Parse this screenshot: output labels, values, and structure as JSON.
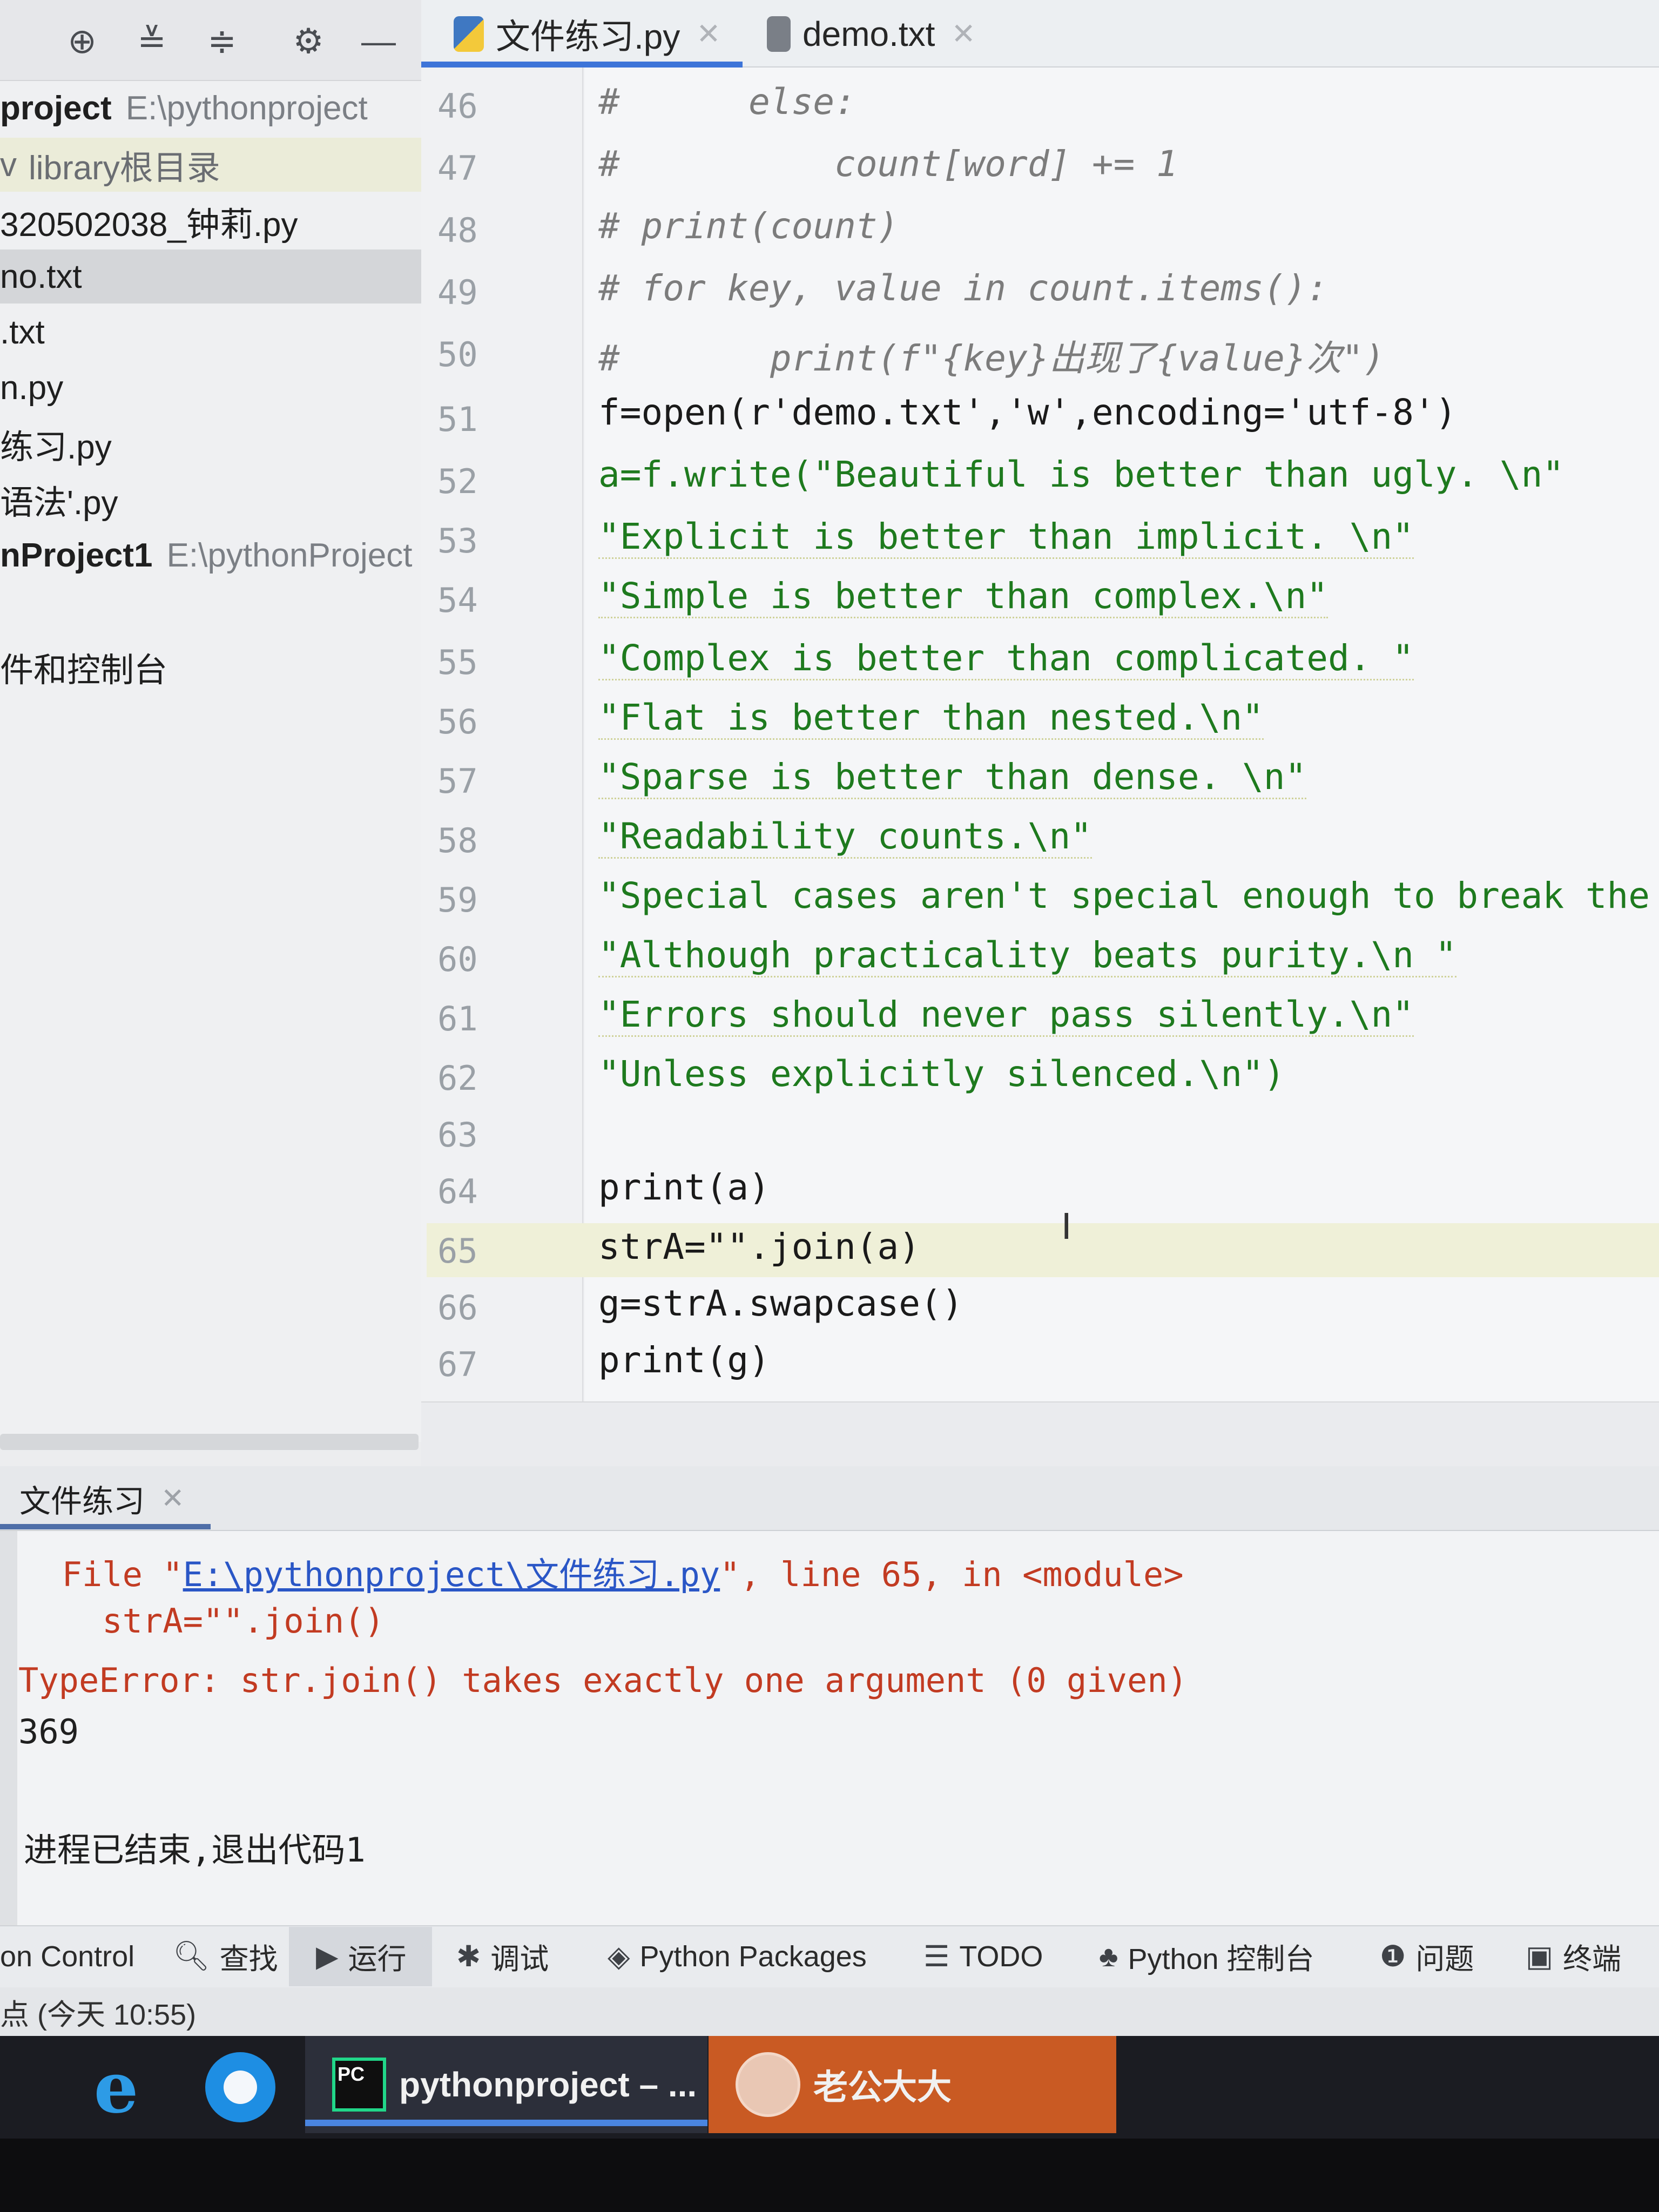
{
  "toolbar": {
    "icons": [
      "crosshair-icon",
      "expand-all-icon",
      "collapse-all-icon",
      "gear-icon",
      "minimize-icon"
    ]
  },
  "tabs": [
    {
      "label": "文件练习.py",
      "icon": "python-file-icon",
      "active": true
    },
    {
      "label": "demo.txt",
      "icon": "text-file-icon",
      "active": false
    }
  ],
  "project_tree": {
    "items": [
      {
        "label": "project",
        "detail": "E:\\pythonproject",
        "bold": true
      },
      {
        "label": "library根目录",
        "prefix": "v"
      },
      {
        "label": "320502038_钟莉.py"
      },
      {
        "label": "no.txt",
        "selected": true
      },
      {
        "label": ".txt"
      },
      {
        "label": "n.py"
      },
      {
        "label": "练习.py"
      },
      {
        "label": "语法'.py"
      },
      {
        "label": "nProject1",
        "detail": "E:\\pythonProject",
        "bold": true
      },
      {
        "label": "件和控制台"
      }
    ]
  },
  "editor": {
    "lines": [
      {
        "n": "46",
        "text": "#      else:"
      },
      {
        "n": "47",
        "text": "#          count[word] += 1"
      },
      {
        "n": "48",
        "text": "# print(count)"
      },
      {
        "n": "49",
        "text": "# for key, value in count.items():"
      },
      {
        "n": "50",
        "text": "#       print(f\"{key}出现了{value}次\")"
      },
      {
        "n": "51",
        "text": "f=open(r'demo.txt','w',encoding='utf-8')"
      },
      {
        "n": "52",
        "text": "a=f.write(\"Beautiful is better than ugly. \\n\""
      },
      {
        "n": "53",
        "text": "\"Explicit is better than implicit. \\n\""
      },
      {
        "n": "54",
        "text": "\"Simple is better than complex.\\n\""
      },
      {
        "n": "55",
        "text": "\"Complex is better than complicated. \""
      },
      {
        "n": "56",
        "text": "\"Flat is better than nested.\\n\""
      },
      {
        "n": "57",
        "text": "\"Sparse is better than dense. \\n\""
      },
      {
        "n": "58",
        "text": "\"Readability counts.\\n\""
      },
      {
        "n": "59",
        "text": "\"Special cases aren't special enough to break the"
      },
      {
        "n": "60",
        "text": "\"Although practicality beats purity.\\n \""
      },
      {
        "n": "61",
        "text": "\"Errors should never pass silently.\\n\""
      },
      {
        "n": "62",
        "text": "\"Unless explicitly silenced.\\n\")"
      },
      {
        "n": "63",
        "text": ""
      },
      {
        "n": "64",
        "text": "print(a)"
      },
      {
        "n": "65",
        "text": "strA=\"\".join(a)"
      },
      {
        "n": "66",
        "text": "g=strA.swapcase()"
      },
      {
        "n": "67",
        "text": "print(g)"
      }
    ]
  },
  "run_panel": {
    "tab_label": "文件练习",
    "console": {
      "file_prefix": "  File \"",
      "file_path": "E:\\pythonproject\\文件练习.py",
      "file_suffix": "\", line 65, in <module>",
      "code_line": "    strA=\"\".join()",
      "error": "TypeError: str.join() takes exactly one argument (0 given)",
      "output": "369",
      "exit_message": "进程已结束,退出代码1"
    }
  },
  "tool_windows": [
    {
      "label": "on Control",
      "icon": ""
    },
    {
      "label": "查找",
      "icon": "search-icon"
    },
    {
      "label": "运行",
      "icon": "run-icon"
    },
    {
      "label": "调试",
      "icon": "debug-icon"
    },
    {
      "label": "Python Packages",
      "icon": "packages-icon"
    },
    {
      "label": "TODO",
      "icon": "list-icon"
    },
    {
      "label": "Python 控制台",
      "icon": "python-icon"
    },
    {
      "label": "问题",
      "icon": "warning-icon"
    },
    {
      "label": "终端",
      "icon": "terminal-icon"
    }
  ],
  "status_bar": {
    "text": "点 (今天 10:55)"
  },
  "taskbar": {
    "pycharm_label": "pythonproject – ...",
    "chat_label": "老公大大"
  }
}
